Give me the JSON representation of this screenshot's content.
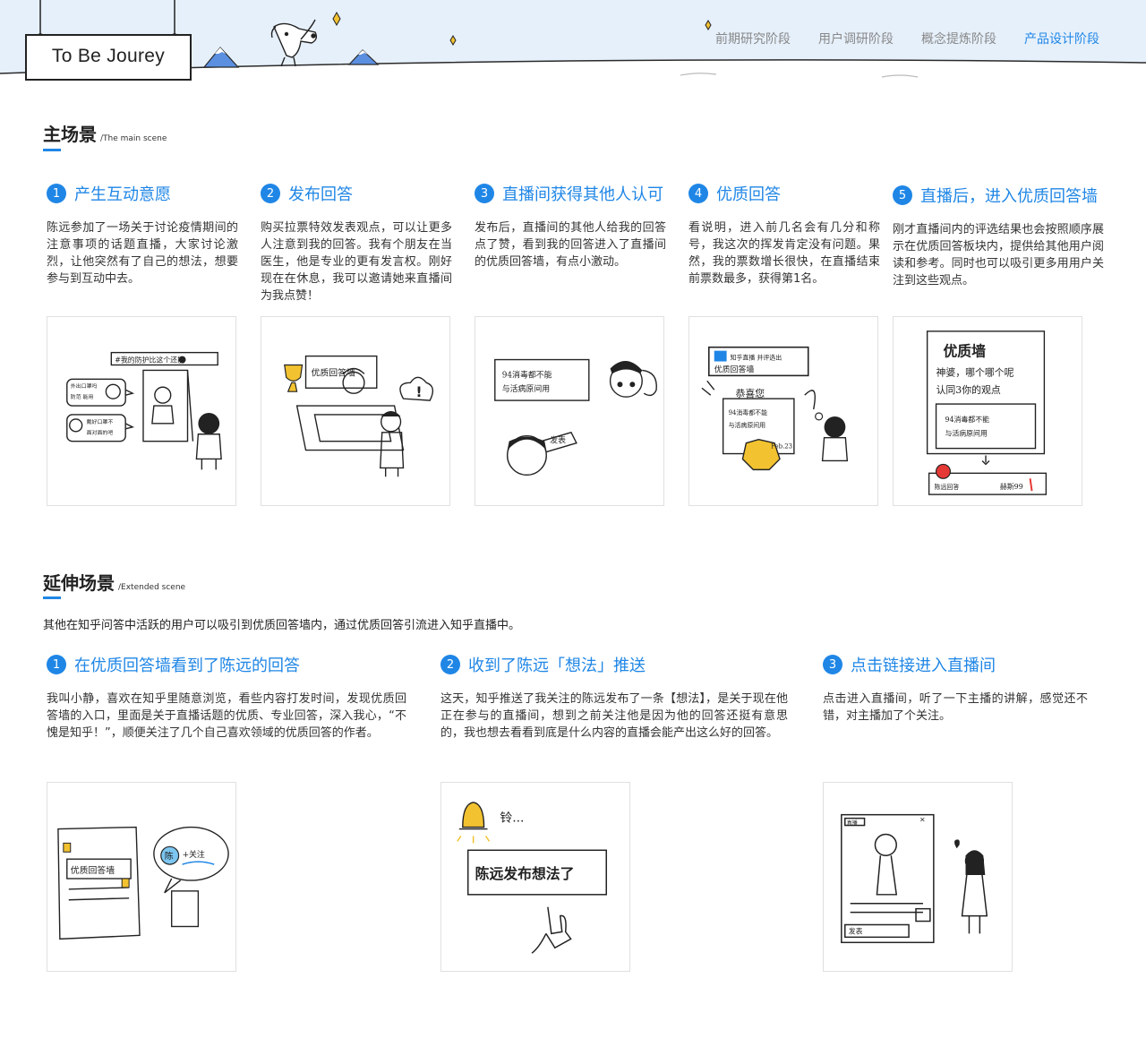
{
  "header": {
    "logo_text": "To Be Jourey",
    "nav": [
      {
        "label": "前期研究阶段",
        "active": false
      },
      {
        "label": "用户调研阶段",
        "active": false
      },
      {
        "label": "概念提炼阶段",
        "active": false
      },
      {
        "label": "产品设计阶段",
        "active": true
      }
    ]
  },
  "main_scene": {
    "title": "主场景",
    "subtitle": "/The main scene",
    "steps": [
      {
        "num": "1",
        "title": "产生互动意愿",
        "body": "陈远参加了一场关于讨论疫情期间的注意事项的话题直播，大家讨论激烈，让他突然有了自己的想法，想要参与到互动中去。"
      },
      {
        "num": "2",
        "title": "发布回答",
        "body": "购买拉票特效发表观点，可以让更多人注意到我的回答。我有个朋友在当医生，他是专业的更有发言权。刚好现在在休息，我可以邀请她来直播间为我点赞！"
      },
      {
        "num": "3",
        "title": "直播间获得其他人认可",
        "body": "发布后，直播间的其他人给我的回答点了赞，看到我的回答进入了直播间的优质回答墙，有点小激动。"
      },
      {
        "num": "4",
        "title": "优质回答",
        "body": "看说明，进入前几名会有几分和称号，我这次的挥发肯定没有问题。果然，我的票数增长很快，在直播结束前票数最多，获得第1名。"
      },
      {
        "num": "5",
        "title": "直播后，进入优质回答墙",
        "body": "刚才直播间内的评选结果也会按照顺序展示在优质回答板块内，提供给其他用户阅读和参考。同时也可以吸引更多用用户关注到这些观点。"
      }
    ],
    "sketches": [
      {
        "texts": [
          "#我的防护比这个还能",
          "外出口罩吗",
          "防范 能用",
          "戴好口罩不",
          "面对面的吧"
        ]
      },
      {
        "texts": [
          "优质回答墙"
        ]
      },
      {
        "texts": [
          "94消毒都不能",
          "与活病原间用",
          "发表"
        ]
      },
      {
        "texts": [
          "知乎直播 并评选出",
          "优质回答墙",
          "恭喜您",
          "94消毒都不能",
          "与活病原间用",
          "Feb.23"
        ]
      },
      {
        "texts": [
          "优质墙",
          "神婆，哪个哪个呢",
          "认同3你的观点",
          "94消毒都不能",
          "与活病原间用",
          "陈远回答",
          "赫斯99"
        ]
      }
    ]
  },
  "extended_scene": {
    "title": "延伸场景",
    "subtitle": "/Extended scene",
    "desc": "其他在知乎问答中活跃的用户可以吸引到优质回答墙内，通过优质回答引流进入知乎直播中。",
    "steps": [
      {
        "num": "1",
        "title": "在优质回答墙看到了陈远的回答",
        "body": "我叫小静，喜欢在知乎里随意浏览，看些内容打发时间，发现优质回答墙的入口，里面是关于直播话题的优质、专业回答，深入我心，“不愧是知乎！”，顺便关注了几个自己喜欢领域的优质回答的作者。"
      },
      {
        "num": "2",
        "title": "收到了陈远「想法」推送",
        "body": "这天，知乎推送了我关注的陈远发布了一条【想法】，是关于现在他正在参与的直播间，想到之前关注他是因为他的回答还挺有意思的，我也想去看看到底是什么内容的直播会能产出这么好的回答。"
      },
      {
        "num": "3",
        "title": "点击链接进入直播间",
        "body": "点击进入直播间，听了一下主播的讲解，感觉还不错，对主播加了个关注。"
      }
    ],
    "sketches": [
      {
        "texts": [
          "优质回答墙",
          "陈",
          "+关注"
        ]
      },
      {
        "texts": [
          "铃...",
          "陈远发布想法了"
        ]
      },
      {
        "texts": [
          "直播",
          "发表"
        ]
      }
    ]
  },
  "colors": {
    "accent": "#1f86e6",
    "sky": "#e6f0fb",
    "mountain": "#5b8fe0",
    "star": "#f2c230"
  }
}
